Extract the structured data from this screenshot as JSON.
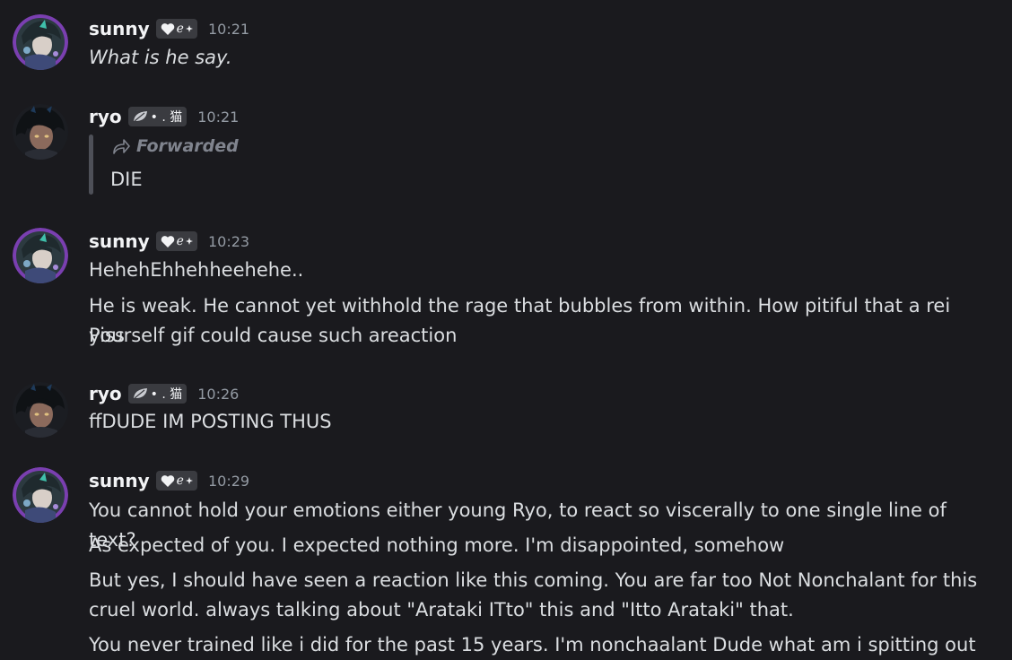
{
  "messages": [
    {
      "author": "sunny",
      "time": "10:21",
      "lines": [
        "What is he say."
      ]
    },
    {
      "author": "ryo",
      "time": "10:21",
      "forwarded_label": "Forwarded",
      "lines": [
        "DIE"
      ]
    },
    {
      "author": "sunny",
      "time": "10:23",
      "lines": [
        "HehehEhhehheehehe..",
        "He is weak. He cannot yet withhold the rage that bubbles from within. How pitiful that a rei Piss",
        "yourself gif could cause such areaction"
      ]
    },
    {
      "author": "ryo",
      "time": "10:26",
      "lines": [
        "ffDUDE IM POSTING THUS"
      ]
    },
    {
      "author": "sunny",
      "time": "10:29",
      "lines": [
        "You cannot hold your emotions either young Ryo, to react so viscerally to one single line of text?",
        "As expected of you. I expected nothing more. I'm disappointed, somehow",
        "But yes, I should have seen a reaction like this coming. You are far too Not Nonchalant for this",
        "cruel world. always talking about \"Arataki ITto\" this and \"Itto Arataki\" that.",
        "You never trained like i did for the past 15 years. I'm nonchaalant Dude what am i spitting out"
      ]
    }
  ],
  "tags": {
    "sunny": {
      "text": "ℯ",
      "icons": [
        "heart-icon",
        "sparkle-icon"
      ]
    },
    "ryo": {
      "text": "• . 猫",
      "icons": [
        "leaf-icon"
      ]
    }
  },
  "colors": {
    "background": "#1a1a1e",
    "text": "#dbdee1",
    "username": "#f2f3f5",
    "timestamp": "#949ba4",
    "muted": "#80848e",
    "tag_bg": "#3a3b40"
  }
}
